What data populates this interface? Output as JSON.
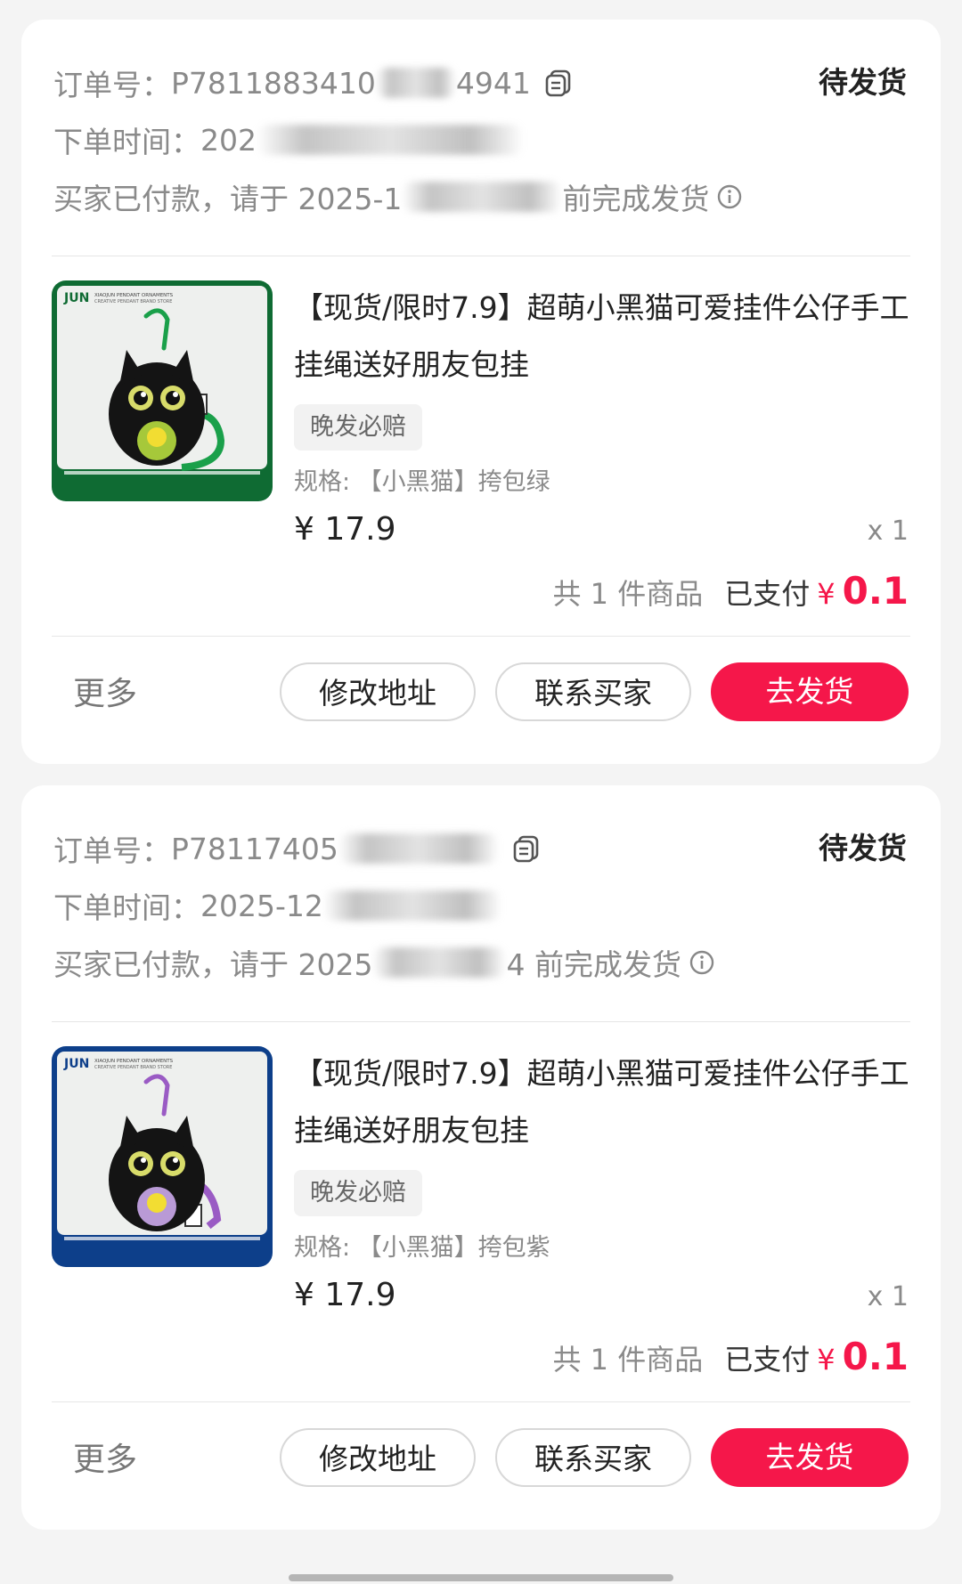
{
  "orders": [
    {
      "order_label": "订单号：",
      "order_no_visible_a": "P7811883410",
      "order_no_visible_b": "4941",
      "status": "待发货",
      "time_label": "下单时间：",
      "time_visible": "202",
      "deadline_prefix": "买家已付款，请于 2025-1",
      "deadline_suffix": "前完成发货",
      "product": {
        "title": "【现货/限时7.9】超萌小黑猫可爱挂件公仔手工挂绳送好朋友包挂",
        "tag": "晚发必赔",
        "spec": "规格: 【小黑猫】挎包绿",
        "price": "¥ 17.9",
        "qty": "x 1",
        "image_color": "#0f6b33",
        "strap_color": "#1aa04a"
      },
      "summary_count": "共 1 件商品",
      "summary_paid": "已支付",
      "summary_currency": "¥",
      "summary_amount": "0.1",
      "more": "更多",
      "btn_address": "修改地址",
      "btn_contact": "联系买家",
      "btn_ship": "去发货"
    },
    {
      "order_label": "订单号：",
      "order_no_visible_a": "P78117405",
      "order_no_visible_b": "",
      "status": "待发货",
      "time_label": "下单时间：",
      "time_visible": "2025-12",
      "deadline_prefix": "买家已付款，请于 2025",
      "deadline_suffix": "4 前完成发货",
      "product": {
        "title": "【现货/限时7.9】超萌小黑猫可爱挂件公仔手工挂绳送好朋友包挂",
        "tag": "晚发必赔",
        "spec": "规格: 【小黑猫】挎包紫",
        "price": "¥ 17.9",
        "qty": "x 1",
        "image_color": "#0d3f8a",
        "strap_color": "#9a5bc4"
      },
      "summary_count": "共 1 件商品",
      "summary_paid": "已支付",
      "summary_currency": "¥",
      "summary_amount": "0.1",
      "more": "更多",
      "btn_address": "修改地址",
      "btn_contact": "联系买家",
      "btn_ship": "去发货"
    }
  ],
  "image_text": {
    "brand": "JUN",
    "line1": "XIAOJUN PENDANT ORNAMENTS",
    "line2": "CREATIVE PENDANT BRAND STORE"
  },
  "colors": {
    "accent": "#f5174a",
    "text_muted": "#8a8a8a"
  }
}
